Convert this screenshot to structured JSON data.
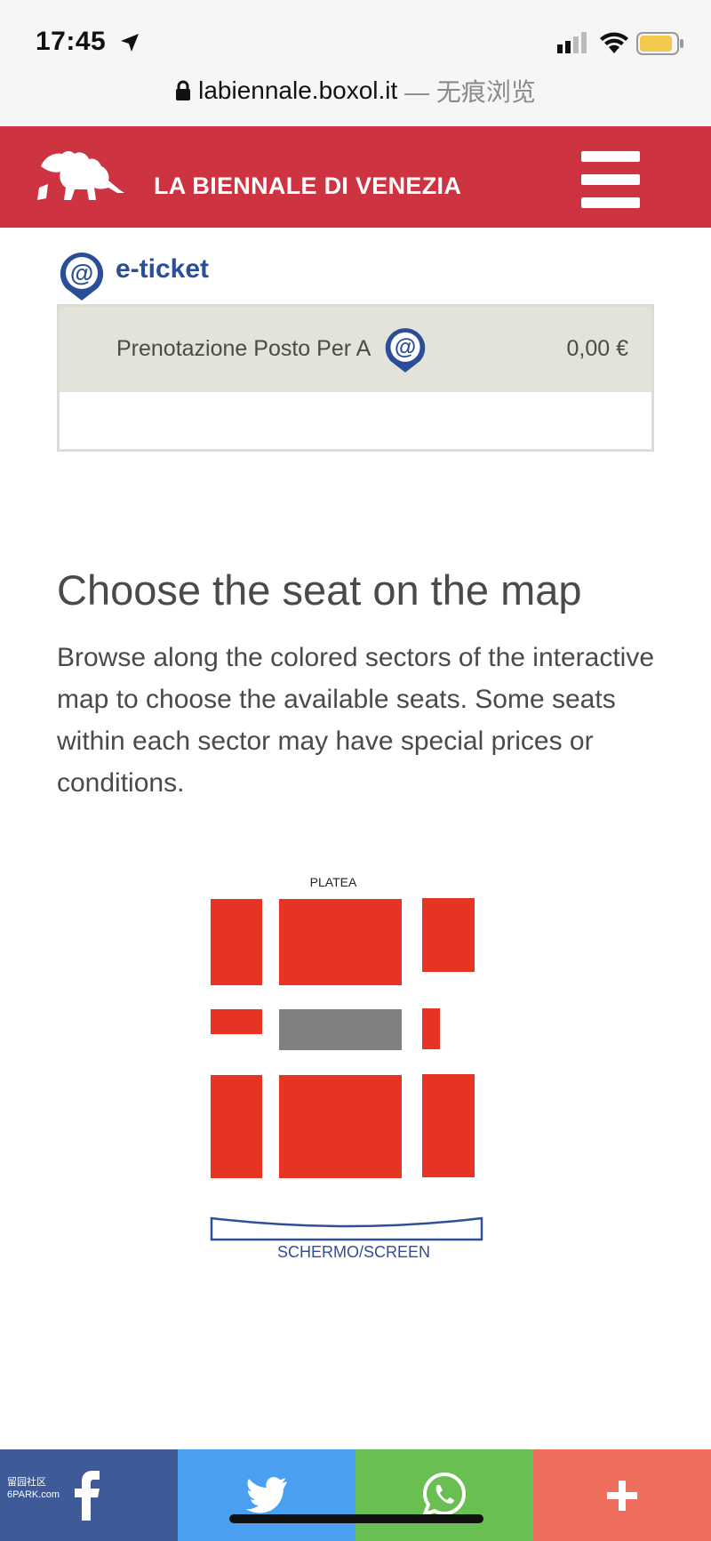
{
  "status_bar": {
    "time": "17:45",
    "url_host": "labiennale.boxol.it",
    "url_suffix": " — 无痕浏览"
  },
  "header": {
    "brand": "LA BIENNALE DI VENEZIA",
    "colors": {
      "background": "#cd3341",
      "text": "#ffffff"
    }
  },
  "eticket": {
    "title": "e-ticket",
    "item_name": "Prenotazione Posto Per A",
    "price": "0,00 €",
    "icon": "at-pin-icon"
  },
  "seat_section": {
    "heading": "Choose the seat on the map",
    "description": "Browse along the colored sectors of the interactive map to choose the available seats. Some seats within each sector may have special prices or conditions."
  },
  "seat_map": {
    "hall_label": "PLATEA",
    "screen_label": "SCHERMO/SCREEN",
    "available_color": "#e63324",
    "unavailable_color": "#808080",
    "sectors": [
      {
        "name": "left-front",
        "status": "available"
      },
      {
        "name": "center-front",
        "status": "available"
      },
      {
        "name": "right-front",
        "status": "available"
      },
      {
        "name": "left-middle",
        "status": "available"
      },
      {
        "name": "center-middle",
        "status": "unavailable"
      },
      {
        "name": "right-middle",
        "status": "available"
      },
      {
        "name": "left-back",
        "status": "available"
      },
      {
        "name": "center-back",
        "status": "available"
      },
      {
        "name": "right-back",
        "status": "available"
      }
    ]
  },
  "share_bar": {
    "watermark": "留园社区\n6PARK.com",
    "buttons": [
      {
        "name": "facebook",
        "icon": "facebook-icon",
        "color": "#3e5a98"
      },
      {
        "name": "twitter",
        "icon": "twitter-icon",
        "color": "#4b9ff0"
      },
      {
        "name": "whatsapp",
        "icon": "whatsapp-icon",
        "color": "#6abf53"
      },
      {
        "name": "more",
        "icon": "plus-icon",
        "color": "#ee6e5e"
      }
    ]
  }
}
